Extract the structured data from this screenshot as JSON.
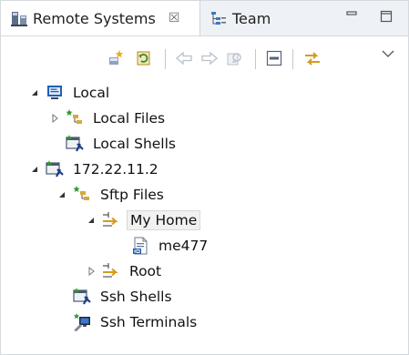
{
  "tabs": [
    {
      "label": "Remote Systems",
      "icon": "remote-systems-icon",
      "active": true,
      "close_glyph": "☒"
    },
    {
      "label": "Team",
      "icon": "team-icon",
      "active": false
    }
  ],
  "window_controls": [
    "minimize-icon",
    "maximize-icon"
  ],
  "toolbar": [
    "new-connection-icon",
    "refresh-icon",
    "back-icon",
    "forward-icon",
    "home-icon",
    "collapse-all-icon",
    "link-with-editor-icon",
    "view-menu-icon"
  ],
  "tree": {
    "local": {
      "label": "Local"
    },
    "local_files": {
      "label": "Local Files"
    },
    "local_shells": {
      "label": "Local Shells"
    },
    "host": {
      "label": "172.22.11.2"
    },
    "sftp_files": {
      "label": "Sftp Files"
    },
    "my_home": {
      "label": "My Home"
    },
    "me477": {
      "label": "me477"
    },
    "root": {
      "label": "Root"
    },
    "ssh_shells": {
      "label": "Ssh Shells"
    },
    "ssh_terminals": {
      "label": "Ssh Terminals"
    }
  },
  "colors": {
    "accent": "#1f5fb8",
    "folder": "#d8a93a",
    "connection": "#2f8a2f"
  }
}
